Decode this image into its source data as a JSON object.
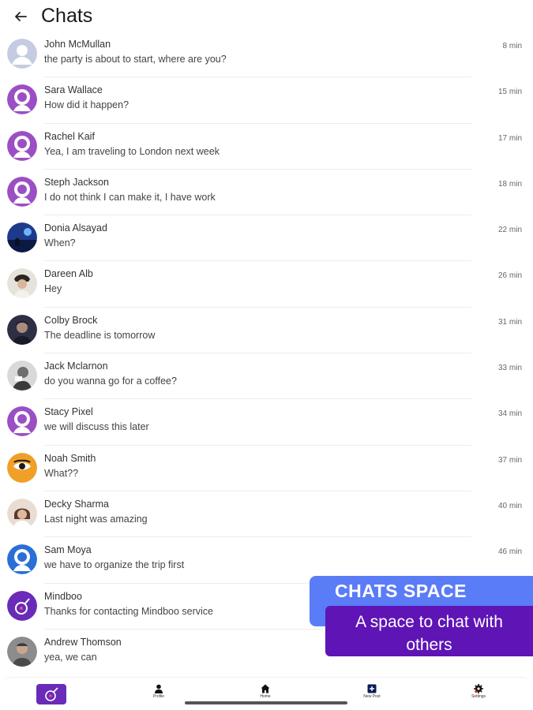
{
  "header": {
    "title": "Chats",
    "back_icon": "arrow-left-icon"
  },
  "chats": [
    {
      "name": "John McMullan",
      "message": "the party is about to start, where are you?",
      "time": "8 min",
      "avatar": "default-gray"
    },
    {
      "name": "Sara Wallace",
      "message": "How did it happen?",
      "time": "15 min",
      "avatar": "default-purple"
    },
    {
      "name": "Rachel Kaif",
      "message": "Yea, I am traveling to London next week",
      "time": "17 min",
      "avatar": "default-purple"
    },
    {
      "name": "Steph Jackson",
      "message": "I do not think I can make it, I have work",
      "time": "18 min",
      "avatar": "default-purple"
    },
    {
      "name": "Donia Alsayad",
      "message": "When?",
      "time": "22 min",
      "avatar": "photo"
    },
    {
      "name": "Dareen Alb",
      "message": "Hey",
      "time": "26 min",
      "avatar": "photo"
    },
    {
      "name": "Colby Brock",
      "message": "The deadline is tomorrow",
      "time": "31 min",
      "avatar": "photo"
    },
    {
      "name": "Jack Mclarnon",
      "message": "do you wanna go for a coffee?",
      "time": "33 min",
      "avatar": "photo"
    },
    {
      "name": "Stacy Pixel",
      "message": "we will discuss this later",
      "time": "34 min",
      "avatar": "default-purple"
    },
    {
      "name": "Noah Smith",
      "message": "What??",
      "time": "37 min",
      "avatar": "photo"
    },
    {
      "name": "Decky Sharma",
      "message": "Last night was amazing",
      "time": "40 min",
      "avatar": "photo"
    },
    {
      "name": "Sam Moya",
      "message": "we have to organize the trip first",
      "time": "46 min",
      "avatar": "default-blue"
    },
    {
      "name": "Mindboo",
      "message": "Thanks for contacting Mindboo service",
      "time": "",
      "avatar": "brand"
    },
    {
      "name": "Andrew Thomson",
      "message": "yea, we can",
      "time": "",
      "avatar": "photo"
    }
  ],
  "banner": {
    "title": "CHATS SPACE",
    "subtitle_line1": "A space to chat with",
    "subtitle_line2": "others"
  },
  "bottom_nav": {
    "profile_label": "Profile",
    "home_label": "Home",
    "new_post_label": "New Post",
    "settings_label": "Settings"
  },
  "colors": {
    "accent_purple": "#9b4fc4",
    "brand": "#6a2bb8",
    "banner_blue": "#5b7cf7",
    "banner_purple": "#5f14b6"
  }
}
